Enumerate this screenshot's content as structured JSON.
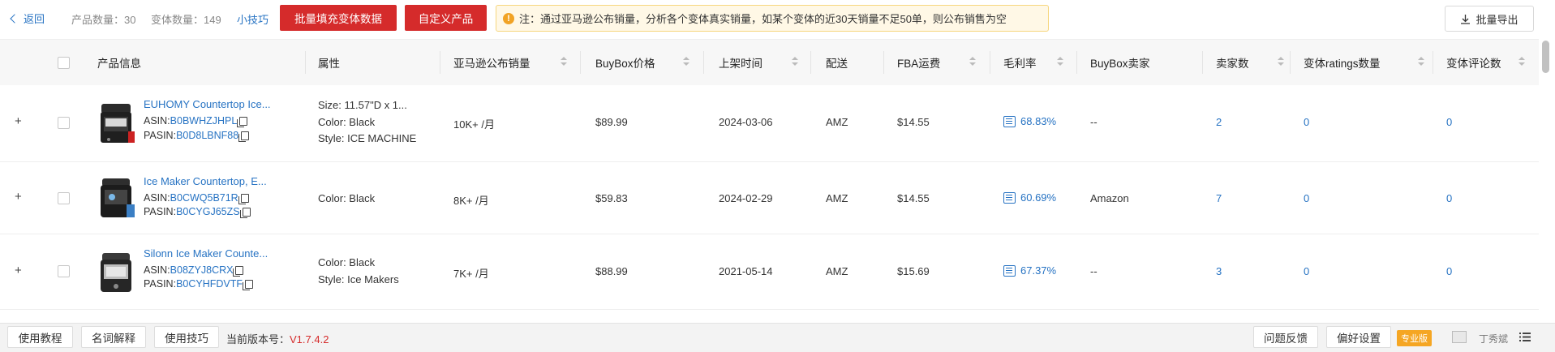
{
  "topbar": {
    "back_label": "返回",
    "product_count_label": "产品数量：",
    "product_count": "30",
    "variant_count_label": "变体数量：",
    "variant_count": "149",
    "tips_label": "小技巧",
    "bulk_fill_label": "批量填充变体数据",
    "custom_product_label": "自定义产品",
    "notice_text": "注：通过亚马逊公布销量，分析各个变体真实销量，如某个变体的近30天销量不足50单，则公布销售为空",
    "export_label": "批量导出"
  },
  "table": {
    "headers": [
      "产品信息",
      "属性",
      "亚马逊公布销量",
      "BuyBox价格",
      "上架时间",
      "配送",
      "FBA运费",
      "毛利率",
      "BuyBox卖家",
      "卖家数",
      "变体ratings数量",
      "变体评论数"
    ],
    "rows": [
      {
        "title": "EUHOMY Countertop Ice...",
        "asin_label": "ASIN: ",
        "asin": "B0BWHZJHPL",
        "pasin_label": "PASIN: ",
        "pasin": "B0D8LBNF88",
        "attrs": [
          "Size: 11.57\"D x 1...",
          "Color: Black",
          "Style: ICE MACHINE"
        ],
        "sales": "10K+ /月",
        "price": "$89.99",
        "date": "2024-03-06",
        "delivery": "AMZ",
        "fba": "$14.55",
        "margin": "68.83%",
        "seller": "--",
        "seller_count": "2",
        "ratings": "0",
        "reviews": "0"
      },
      {
        "title": "Ice Maker Countertop, E...",
        "asin_label": "ASIN: ",
        "asin": "B0CWQ5B71R",
        "pasin_label": "PASIN: ",
        "pasin": "B0CYGJ65ZS",
        "attrs": [
          "Color: Black"
        ],
        "sales": "8K+ /月",
        "price": "$59.83",
        "date": "2024-02-29",
        "delivery": "AMZ",
        "fba": "$14.55",
        "margin": "60.69%",
        "seller": "Amazon",
        "seller_count": "7",
        "ratings": "0",
        "reviews": "0"
      },
      {
        "title": "Silonn Ice Maker Counte...",
        "asin_label": "ASIN: ",
        "asin": "B08ZYJ8CRX",
        "pasin_label": "PASIN: ",
        "pasin": "B0CYHFDVTF",
        "attrs": [
          "Color: Black",
          "Style: Ice Makers"
        ],
        "sales": "7K+ /月",
        "price": "$88.99",
        "date": "2021-05-14",
        "delivery": "AMZ",
        "fba": "$15.69",
        "margin": "67.37%",
        "seller": "--",
        "seller_count": "3",
        "ratings": "0",
        "reviews": "0"
      }
    ]
  },
  "footer": {
    "tutorial_label": "使用教程",
    "glossary_label": "名词解释",
    "tips_label": "使用技巧",
    "version_label": "当前版本号：",
    "version": "V1.7.4.2",
    "feedback_label": "问题反馈",
    "settings_label": "偏好设置",
    "pro_badge": "专业版",
    "username": "丁秀斌"
  }
}
